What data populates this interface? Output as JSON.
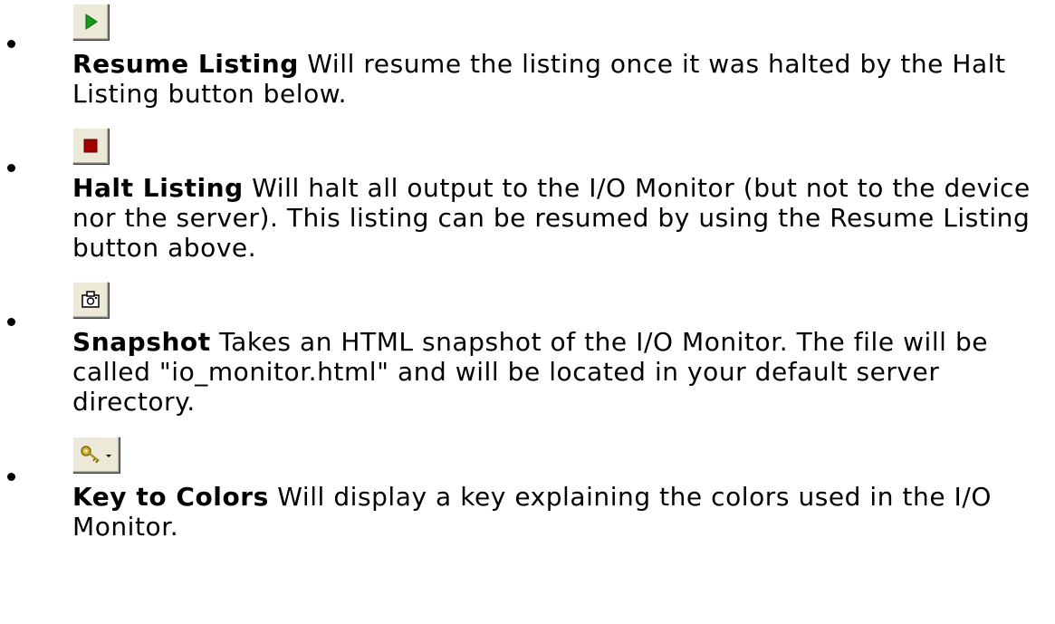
{
  "items": [
    {
      "icon": "play-icon",
      "title": "Resume Listing",
      "description": " Will resume the listing once it was halted by the Halt Listing button below."
    },
    {
      "icon": "stop-icon",
      "title": "Halt Listing",
      "description": " Will halt all output to the I/O Monitor (but not to the device nor the server). This listing can be resumed by using the Resume Listing button above."
    },
    {
      "icon": "camera-icon",
      "title": "Snapshot",
      "description": " Takes an HTML snapshot of the I/O Monitor. The file will be called \"io_monitor.html\" and will be located in your default server directory."
    },
    {
      "icon": "key-dropdown-icon",
      "title": "Key to Colors",
      "description": " Will display a key explaining the colors used in the I/O Monitor."
    }
  ],
  "colors": {
    "button_face": "#ece9d8",
    "play_green": "#1a9a1a",
    "stop_red": "#a00000",
    "key_gold": "#d4b020"
  }
}
